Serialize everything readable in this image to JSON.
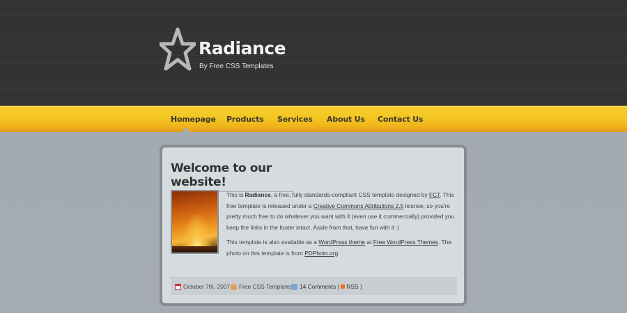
{
  "site": {
    "title": "Radiance",
    "subtitle": "By Free CSS Templates"
  },
  "menu": {
    "items": [
      {
        "label": "Homepage",
        "active": true
      },
      {
        "label": "Products"
      },
      {
        "label": "Services"
      },
      {
        "label": "About Us"
      },
      {
        "label": "Contact Us"
      }
    ]
  },
  "post": {
    "title": "Welcome to our website!",
    "p1": {
      "t1": "This is ",
      "bold": "Radiance",
      "t2": ", a free, fully standards-compliant CSS template designed by ",
      "link1": "FCT",
      "t3": ". This free template is released under a ",
      "link2": "Creative Commons Attributions 2.5",
      "t4": " license, so you're pretty much free to do whatever you want with it (even use it commercially) provided you keep the links in the footer intact. Aside from that, have fun with it :)"
    },
    "p2": {
      "t1": "This template is also available as a ",
      "link1": "WordPress theme",
      "t2": " at ",
      "link2": "Free WordPress Themes",
      "t3": ". The photo on this template is from ",
      "link3": "PDPhoto.org",
      "t4": "."
    },
    "meta": {
      "date": "October 7th, 2007",
      "author": "Free CSS Templates",
      "comments": "14 Comments",
      "rss_open": "(",
      "rss": "RSS",
      "rss_close": ")"
    }
  },
  "colors": {
    "header_bg": "#353535",
    "menu_yellow": "#f3c623",
    "menu_orange": "#e7951b",
    "page_bg": "#a5abb3",
    "post_bg": "#d6dbde",
    "post_border": "#878c91"
  },
  "icons": [
    "star-logo-icon",
    "calendar-icon",
    "author-icon",
    "comment-icon",
    "rss-icon"
  ]
}
